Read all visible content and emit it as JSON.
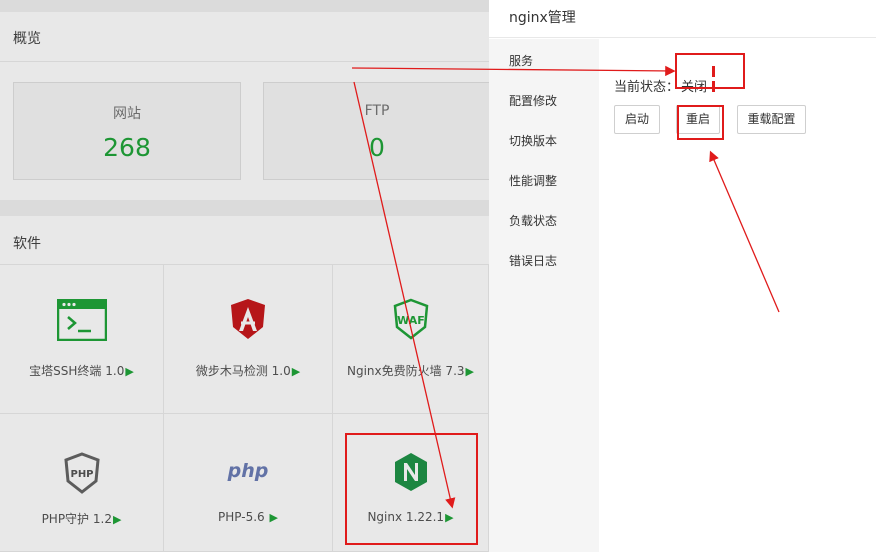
{
  "overview": {
    "title": "概览",
    "stats": [
      {
        "label": "网站",
        "value": "268"
      },
      {
        "label": "FTP",
        "value": "0"
      }
    ]
  },
  "software": {
    "title": "软件",
    "items": [
      {
        "label": "宝塔SSH终端 1.0",
        "icon": "terminal-icon"
      },
      {
        "label": "微步木马检测 1.0",
        "icon": "shield-a-icon"
      },
      {
        "label": "Nginx免费防火墙 7.3",
        "icon": "waf-icon"
      },
      {
        "label": "PHP守护 1.2",
        "icon": "php-shield-icon"
      },
      {
        "label": "PHP-5.6",
        "icon": "php-icon"
      },
      {
        "label": "Nginx 1.22.1",
        "icon": "nginx-icon"
      }
    ],
    "play_glyph": "▶"
  },
  "drawer": {
    "title": "nginx管理",
    "nav": [
      "服务",
      "配置修改",
      "切换版本",
      "性能调整",
      "负载状态",
      "错误日志"
    ],
    "status_label": "当前状态：",
    "status_value": "关闭",
    "buttons": {
      "start": "启动",
      "restart": "重启",
      "reload": "重载配置"
    }
  },
  "colors": {
    "accent": "#20a53a",
    "annotation": "#e01b1b",
    "stopped": "#e01b1b"
  }
}
